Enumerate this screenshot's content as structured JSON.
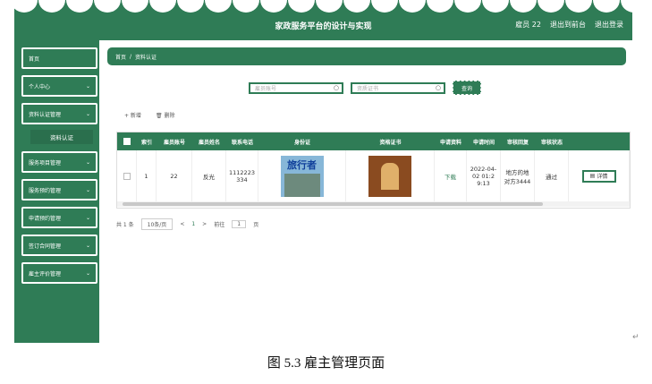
{
  "header": {
    "title": "家政服务平台的设计与实现",
    "user": "雇员 22",
    "back_to_admin": "退出到前台",
    "logout": "退出登录"
  },
  "sidebar": {
    "items": [
      {
        "label": "首页",
        "chevron": ""
      },
      {
        "label": "个人中心",
        "chevron": "⌄"
      },
      {
        "label": "资料认证管理",
        "chevron": "⌄"
      },
      {
        "label": "资料认证",
        "chevron": ""
      },
      {
        "label": "服务项目管理",
        "chevron": "⌄"
      },
      {
        "label": "服务预约管理",
        "chevron": "⌄"
      },
      {
        "label": "申请预约管理",
        "chevron": "⌄"
      },
      {
        "label": "签订合同管理",
        "chevron": "⌄"
      },
      {
        "label": "雇主评价管理",
        "chevron": "⌄"
      }
    ]
  },
  "breadcrumb": {
    "home": "首页",
    "sep": "/",
    "current": "资料认证"
  },
  "search": {
    "field1_placeholder": "雇员账号",
    "field2_placeholder": "资质证书",
    "button": "查询"
  },
  "toolbar": {
    "add": "+ 新增",
    "delete": "🗑 删除"
  },
  "table": {
    "headers": [
      "",
      "索引",
      "雇员账号",
      "雇员姓名",
      "联系电话",
      "身份证",
      "资格证书",
      "申请资料",
      "申请时间",
      "审核回复",
      "审核状态",
      ""
    ],
    "row": {
      "index": "1",
      "account": "22",
      "name": "反光",
      "phone": "1112223334",
      "id_image_text": "旅行者",
      "download": "下载",
      "time": "2022-04-02 01:29:13",
      "reply": "地方的地对方3444",
      "status": "通过",
      "detail": "详情"
    }
  },
  "pager": {
    "total": "共 1 条",
    "page_size": "10条/页",
    "prev": "<",
    "page": "1",
    "next": ">",
    "goto": "前往",
    "goto_value": "1",
    "page_suffix": "页"
  },
  "caption": "图 5.3 雇主管理页面",
  "colors": {
    "primary": "#2f7c56"
  }
}
